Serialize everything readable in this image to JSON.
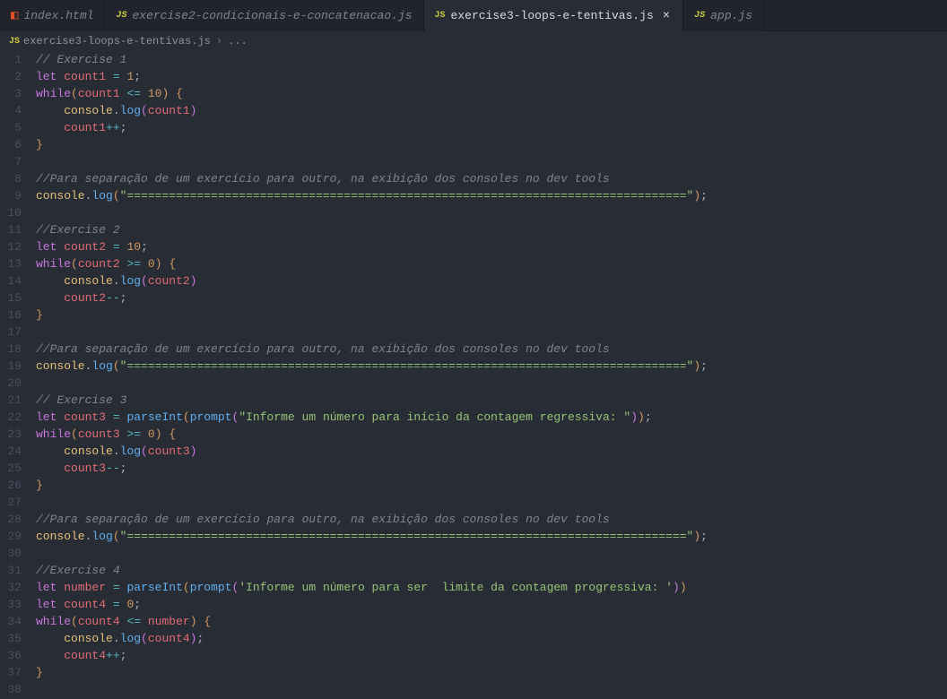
{
  "tabs": [
    {
      "icon": "html5",
      "label": "index.html",
      "active": false
    },
    {
      "icon": "js",
      "label": "exercise2-condicionais-e-concatenacao.js",
      "active": false
    },
    {
      "icon": "js",
      "label": "exercise3-loops-e-tentivas.js",
      "active": true
    },
    {
      "icon": "js",
      "label": "app.js",
      "active": false
    }
  ],
  "breadcrumb": {
    "icon": "js",
    "file": "exercise3-loops-e-tentivas.js",
    "separator": "›",
    "after": "..."
  },
  "code": {
    "lines": [
      {
        "n": 1,
        "tokens": [
          {
            "t": "comment",
            "v": "// Exercise 1"
          }
        ]
      },
      {
        "n": 2,
        "tokens": [
          {
            "t": "keyword",
            "v": "let"
          },
          {
            "t": "plain",
            "v": " "
          },
          {
            "t": "variable",
            "v": "count1"
          },
          {
            "t": "plain",
            "v": " "
          },
          {
            "t": "operator",
            "v": "="
          },
          {
            "t": "plain",
            "v": " "
          },
          {
            "t": "number",
            "v": "1"
          },
          {
            "t": "punct",
            "v": ";"
          }
        ]
      },
      {
        "n": 3,
        "tokens": [
          {
            "t": "keyword",
            "v": "while"
          },
          {
            "t": "brace-gold",
            "v": "("
          },
          {
            "t": "variable",
            "v": "count1"
          },
          {
            "t": "plain",
            "v": " "
          },
          {
            "t": "operator",
            "v": "<="
          },
          {
            "t": "plain",
            "v": " "
          },
          {
            "t": "number",
            "v": "10"
          },
          {
            "t": "brace-gold",
            "v": ")"
          },
          {
            "t": "plain",
            "v": " "
          },
          {
            "t": "brace-gold",
            "v": "{"
          }
        ]
      },
      {
        "n": 4,
        "tokens": [
          {
            "t": "plain",
            "v": "    "
          },
          {
            "t": "object",
            "v": "console"
          },
          {
            "t": "punct",
            "v": "."
          },
          {
            "t": "method",
            "v": "log"
          },
          {
            "t": "brace",
            "v": "("
          },
          {
            "t": "variable",
            "v": "count1"
          },
          {
            "t": "brace",
            "v": ")"
          }
        ]
      },
      {
        "n": 5,
        "tokens": [
          {
            "t": "plain",
            "v": "    "
          },
          {
            "t": "variable",
            "v": "count1"
          },
          {
            "t": "operator",
            "v": "++"
          },
          {
            "t": "punct",
            "v": ";"
          }
        ]
      },
      {
        "n": 6,
        "tokens": [
          {
            "t": "brace-gold",
            "v": "}"
          }
        ]
      },
      {
        "n": 7,
        "tokens": []
      },
      {
        "n": 8,
        "tokens": [
          {
            "t": "comment",
            "v": "//Para separação de um exercício para outro, na exibição dos consoles no dev tools"
          }
        ]
      },
      {
        "n": 9,
        "tokens": [
          {
            "t": "object",
            "v": "console"
          },
          {
            "t": "punct",
            "v": "."
          },
          {
            "t": "method",
            "v": "log"
          },
          {
            "t": "brace-gold",
            "v": "("
          },
          {
            "t": "string",
            "v": "\"================================================================================\""
          },
          {
            "t": "brace-gold",
            "v": ")"
          },
          {
            "t": "punct",
            "v": ";"
          }
        ]
      },
      {
        "n": 10,
        "tokens": []
      },
      {
        "n": 11,
        "tokens": [
          {
            "t": "comment",
            "v": "//Exercise 2"
          }
        ]
      },
      {
        "n": 12,
        "tokens": [
          {
            "t": "keyword",
            "v": "let"
          },
          {
            "t": "plain",
            "v": " "
          },
          {
            "t": "variable",
            "v": "count2"
          },
          {
            "t": "plain",
            "v": " "
          },
          {
            "t": "operator",
            "v": "="
          },
          {
            "t": "plain",
            "v": " "
          },
          {
            "t": "number",
            "v": "10"
          },
          {
            "t": "punct",
            "v": ";"
          }
        ]
      },
      {
        "n": 13,
        "tokens": [
          {
            "t": "keyword",
            "v": "while"
          },
          {
            "t": "brace-gold",
            "v": "("
          },
          {
            "t": "variable",
            "v": "count2"
          },
          {
            "t": "plain",
            "v": " "
          },
          {
            "t": "operator",
            "v": ">="
          },
          {
            "t": "plain",
            "v": " "
          },
          {
            "t": "number",
            "v": "0"
          },
          {
            "t": "brace-gold",
            "v": ")"
          },
          {
            "t": "plain",
            "v": " "
          },
          {
            "t": "brace-gold",
            "v": "{"
          }
        ]
      },
      {
        "n": 14,
        "tokens": [
          {
            "t": "plain",
            "v": "    "
          },
          {
            "t": "object",
            "v": "console"
          },
          {
            "t": "punct",
            "v": "."
          },
          {
            "t": "method",
            "v": "log"
          },
          {
            "t": "brace",
            "v": "("
          },
          {
            "t": "variable",
            "v": "count2"
          },
          {
            "t": "brace",
            "v": ")"
          }
        ]
      },
      {
        "n": 15,
        "tokens": [
          {
            "t": "plain",
            "v": "    "
          },
          {
            "t": "variable",
            "v": "count2"
          },
          {
            "t": "operator",
            "v": "--"
          },
          {
            "t": "punct",
            "v": ";"
          }
        ]
      },
      {
        "n": 16,
        "tokens": [
          {
            "t": "brace-gold",
            "v": "}"
          }
        ]
      },
      {
        "n": 17,
        "tokens": []
      },
      {
        "n": 18,
        "tokens": [
          {
            "t": "comment",
            "v": "//Para separação de um exercício para outro, na exibição dos consoles no dev tools"
          }
        ]
      },
      {
        "n": 19,
        "tokens": [
          {
            "t": "object",
            "v": "console"
          },
          {
            "t": "punct",
            "v": "."
          },
          {
            "t": "method",
            "v": "log"
          },
          {
            "t": "brace-gold",
            "v": "("
          },
          {
            "t": "string",
            "v": "\"================================================================================\""
          },
          {
            "t": "brace-gold",
            "v": ")"
          },
          {
            "t": "punct",
            "v": ";"
          }
        ]
      },
      {
        "n": 20,
        "tokens": []
      },
      {
        "n": 21,
        "tokens": [
          {
            "t": "comment",
            "v": "// Exercise 3"
          }
        ]
      },
      {
        "n": 22,
        "tokens": [
          {
            "t": "keyword",
            "v": "let"
          },
          {
            "t": "plain",
            "v": " "
          },
          {
            "t": "variable",
            "v": "count3"
          },
          {
            "t": "plain",
            "v": " "
          },
          {
            "t": "operator",
            "v": "="
          },
          {
            "t": "plain",
            "v": " "
          },
          {
            "t": "func",
            "v": "parseInt"
          },
          {
            "t": "brace-gold",
            "v": "("
          },
          {
            "t": "func",
            "v": "prompt"
          },
          {
            "t": "brace",
            "v": "("
          },
          {
            "t": "string",
            "v": "\"Informe um número para início da contagem regressiva: \""
          },
          {
            "t": "brace",
            "v": ")"
          },
          {
            "t": "brace-gold",
            "v": ")"
          },
          {
            "t": "punct",
            "v": ";"
          }
        ]
      },
      {
        "n": 23,
        "tokens": [
          {
            "t": "keyword",
            "v": "while"
          },
          {
            "t": "brace-gold",
            "v": "("
          },
          {
            "t": "variable",
            "v": "count3"
          },
          {
            "t": "plain",
            "v": " "
          },
          {
            "t": "operator",
            "v": ">="
          },
          {
            "t": "plain",
            "v": " "
          },
          {
            "t": "number",
            "v": "0"
          },
          {
            "t": "brace-gold",
            "v": ")"
          },
          {
            "t": "plain",
            "v": " "
          },
          {
            "t": "brace-gold",
            "v": "{"
          }
        ]
      },
      {
        "n": 24,
        "tokens": [
          {
            "t": "plain",
            "v": "    "
          },
          {
            "t": "object",
            "v": "console"
          },
          {
            "t": "punct",
            "v": "."
          },
          {
            "t": "method",
            "v": "log"
          },
          {
            "t": "brace",
            "v": "("
          },
          {
            "t": "variable",
            "v": "count3"
          },
          {
            "t": "brace",
            "v": ")"
          }
        ]
      },
      {
        "n": 25,
        "tokens": [
          {
            "t": "plain",
            "v": "    "
          },
          {
            "t": "variable",
            "v": "count3"
          },
          {
            "t": "operator",
            "v": "--"
          },
          {
            "t": "punct",
            "v": ";"
          }
        ]
      },
      {
        "n": 26,
        "tokens": [
          {
            "t": "brace-gold",
            "v": "}"
          }
        ]
      },
      {
        "n": 27,
        "tokens": []
      },
      {
        "n": 28,
        "tokens": [
          {
            "t": "comment",
            "v": "//Para separação de um exercício para outro, na exibição dos consoles no dev tools"
          }
        ]
      },
      {
        "n": 29,
        "tokens": [
          {
            "t": "object",
            "v": "console"
          },
          {
            "t": "punct",
            "v": "."
          },
          {
            "t": "method",
            "v": "log"
          },
          {
            "t": "brace-gold",
            "v": "("
          },
          {
            "t": "string",
            "v": "\"================================================================================\""
          },
          {
            "t": "brace-gold",
            "v": ")"
          },
          {
            "t": "punct",
            "v": ";"
          }
        ]
      },
      {
        "n": 30,
        "tokens": []
      },
      {
        "n": 31,
        "tokens": [
          {
            "t": "comment",
            "v": "//Exercise 4"
          }
        ]
      },
      {
        "n": 32,
        "tokens": [
          {
            "t": "keyword",
            "v": "let"
          },
          {
            "t": "plain",
            "v": " "
          },
          {
            "t": "variable",
            "v": "number"
          },
          {
            "t": "plain",
            "v": " "
          },
          {
            "t": "operator",
            "v": "="
          },
          {
            "t": "plain",
            "v": " "
          },
          {
            "t": "func",
            "v": "parseInt"
          },
          {
            "t": "brace-gold",
            "v": "("
          },
          {
            "t": "func",
            "v": "prompt"
          },
          {
            "t": "brace",
            "v": "("
          },
          {
            "t": "string",
            "v": "'Informe um número para ser  limite da contagem progressiva: '"
          },
          {
            "t": "brace",
            "v": ")"
          },
          {
            "t": "brace-gold",
            "v": ")"
          }
        ]
      },
      {
        "n": 33,
        "tokens": [
          {
            "t": "keyword",
            "v": "let"
          },
          {
            "t": "plain",
            "v": " "
          },
          {
            "t": "variable",
            "v": "count4"
          },
          {
            "t": "plain",
            "v": " "
          },
          {
            "t": "operator",
            "v": "="
          },
          {
            "t": "plain",
            "v": " "
          },
          {
            "t": "number",
            "v": "0"
          },
          {
            "t": "punct",
            "v": ";"
          }
        ]
      },
      {
        "n": 34,
        "tokens": [
          {
            "t": "keyword",
            "v": "while"
          },
          {
            "t": "brace-gold",
            "v": "("
          },
          {
            "t": "variable",
            "v": "count4"
          },
          {
            "t": "plain",
            "v": " "
          },
          {
            "t": "operator",
            "v": "<="
          },
          {
            "t": "plain",
            "v": " "
          },
          {
            "t": "variable",
            "v": "number"
          },
          {
            "t": "brace-gold",
            "v": ")"
          },
          {
            "t": "plain",
            "v": " "
          },
          {
            "t": "brace-gold",
            "v": "{"
          }
        ]
      },
      {
        "n": 35,
        "tokens": [
          {
            "t": "plain",
            "v": "    "
          },
          {
            "t": "object",
            "v": "console"
          },
          {
            "t": "punct",
            "v": "."
          },
          {
            "t": "method",
            "v": "log"
          },
          {
            "t": "brace",
            "v": "("
          },
          {
            "t": "variable",
            "v": "count4"
          },
          {
            "t": "brace",
            "v": ")"
          },
          {
            "t": "punct",
            "v": ";"
          }
        ]
      },
      {
        "n": 36,
        "tokens": [
          {
            "t": "plain",
            "v": "    "
          },
          {
            "t": "variable",
            "v": "count4"
          },
          {
            "t": "operator",
            "v": "++"
          },
          {
            "t": "punct",
            "v": ";"
          }
        ]
      },
      {
        "n": 37,
        "tokens": [
          {
            "t": "brace-gold",
            "v": "}"
          }
        ]
      },
      {
        "n": 38,
        "tokens": []
      }
    ]
  }
}
